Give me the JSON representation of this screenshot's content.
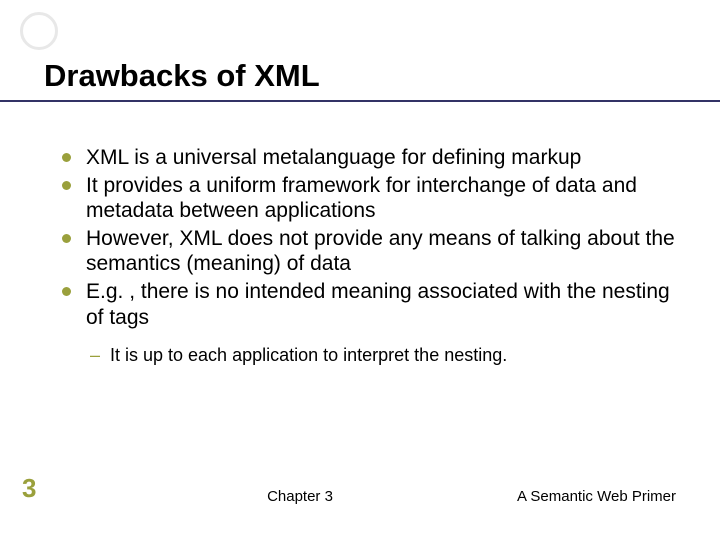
{
  "slide": {
    "title": "Drawbacks of XML",
    "bullets": [
      "XML is a universal metalanguage for defining markup",
      "It provides a uniform framework for interchange of data and metadata between applications",
      "However, XML does not provide any means of talking about the semantics (meaning) of data",
      "E.g. , there is no intended meaning associated with the nesting of tags"
    ],
    "sub_bullets": [
      "It is up to each application to interpret the nesting."
    ],
    "page_number": "3",
    "footer_center": "Chapter 3",
    "footer_right": "A Semantic Web Primer"
  }
}
